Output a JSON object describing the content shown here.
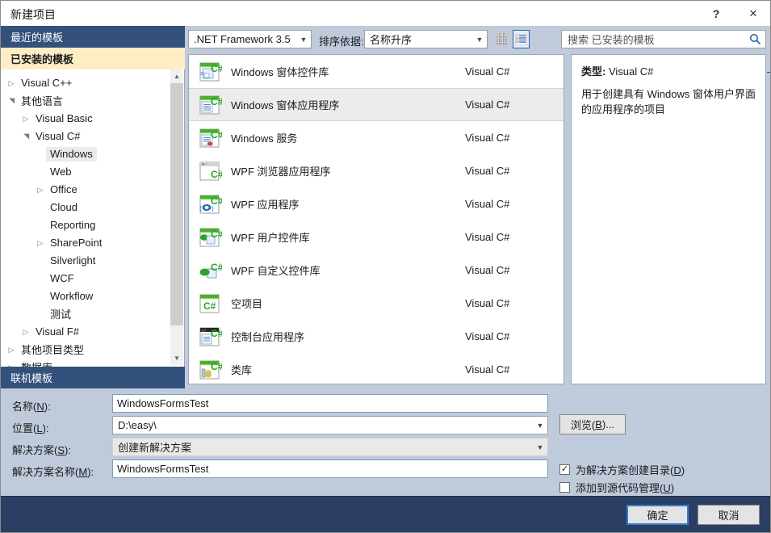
{
  "titlebar": {
    "title": "新建项目",
    "help_icon": "?",
    "close_icon": "×"
  },
  "sidebar": {
    "band_recent": "最近的模板",
    "band_installed": "已安装的模板",
    "band_online": "联机模板",
    "tree": [
      {
        "label": "Visual C++",
        "level": 0,
        "twisty": "collapsed",
        "selected": false
      },
      {
        "label": "其他语言",
        "level": 0,
        "twisty": "expanded",
        "selected": false
      },
      {
        "label": "Visual Basic",
        "level": 1,
        "twisty": "collapsed",
        "selected": false
      },
      {
        "label": "Visual C#",
        "level": 1,
        "twisty": "expanded",
        "selected": false
      },
      {
        "label": "Windows",
        "level": 2,
        "twisty": "none",
        "selected": true
      },
      {
        "label": "Web",
        "level": 2,
        "twisty": "none",
        "selected": false
      },
      {
        "label": "Office",
        "level": 2,
        "twisty": "collapsed",
        "selected": false
      },
      {
        "label": "Cloud",
        "level": 2,
        "twisty": "none",
        "selected": false
      },
      {
        "label": "Reporting",
        "level": 2,
        "twisty": "none",
        "selected": false
      },
      {
        "label": "SharePoint",
        "level": 2,
        "twisty": "collapsed",
        "selected": false
      },
      {
        "label": "Silverlight",
        "level": 2,
        "twisty": "none",
        "selected": false
      },
      {
        "label": "WCF",
        "level": 2,
        "twisty": "none",
        "selected": false
      },
      {
        "label": "Workflow",
        "level": 2,
        "twisty": "none",
        "selected": false
      },
      {
        "label": "测试",
        "level": 2,
        "twisty": "none",
        "selected": false
      },
      {
        "label": "Visual F#",
        "level": 1,
        "twisty": "collapsed",
        "selected": false
      },
      {
        "label": "其他项目类型",
        "level": 0,
        "twisty": "collapsed",
        "selected": false
      },
      {
        "label": "数据库",
        "level": 0,
        "twisty": "collapsed",
        "selected": false
      }
    ]
  },
  "toolbar": {
    "framework": ".NET Framework 3.5",
    "sort_label": "排序依据:",
    "sort_value": "名称升序",
    "view_medium_icon": "medium-icons-view-icon",
    "view_list_icon": "list-view-icon",
    "view_selected": "list"
  },
  "search": {
    "placeholder": "搜索 已安装的模板",
    "icon": "search-icon"
  },
  "templates": [
    {
      "name": "Windows 窗体控件库",
      "lang": "Visual C#",
      "icon": "winforms-control-library-icon",
      "selected": false
    },
    {
      "name": "Windows 窗体应用程序",
      "lang": "Visual C#",
      "icon": "winforms-app-icon",
      "selected": true
    },
    {
      "name": "Windows 服务",
      "lang": "Visual C#",
      "icon": "windows-service-icon",
      "selected": false
    },
    {
      "name": "WPF 浏览器应用程序",
      "lang": "Visual C#",
      "icon": "wpf-browser-app-icon",
      "selected": false
    },
    {
      "name": "WPF 应用程序",
      "lang": "Visual C#",
      "icon": "wpf-app-icon",
      "selected": false
    },
    {
      "name": "WPF 用户控件库",
      "lang": "Visual C#",
      "icon": "wpf-user-control-icon",
      "selected": false
    },
    {
      "name": "WPF 自定义控件库",
      "lang": "Visual C#",
      "icon": "wpf-custom-control-icon",
      "selected": false
    },
    {
      "name": "空项目",
      "lang": "Visual C#",
      "icon": "empty-project-icon",
      "selected": false
    },
    {
      "name": "控制台应用程序",
      "lang": "Visual C#",
      "icon": "console-app-icon",
      "selected": false
    },
    {
      "name": "类库",
      "lang": "Visual C#",
      "icon": "class-library-icon",
      "selected": false
    }
  ],
  "description": {
    "type_label": "类型:",
    "type_value": "Visual C#",
    "text": "用于创建具有 Windows 窗体用户界面的应用程序的项目",
    "edge_link": "（"
  },
  "form": {
    "name_label_pre": "名称(",
    "name_label_key": "N",
    "name_label_post": "):",
    "name_value": "WindowsFormsTest",
    "location_label_pre": "位置(",
    "location_label_key": "L",
    "location_label_post": "):",
    "location_value": "D:\\easy\\",
    "solution_label_pre": "解决方案(",
    "solution_label_key": "S",
    "solution_label_post": "):",
    "solution_value": "创建新解决方案",
    "solution_name_label_pre": "解决方案名称(",
    "solution_name_label_key": "M",
    "solution_name_label_post": "):",
    "solution_name_value": "WindowsFormsTest",
    "browse_pre": "浏览(",
    "browse_key": "B",
    "browse_post": ")...",
    "chk_dir_pre": "为解决方案创建目录(",
    "chk_dir_key": "D",
    "chk_dir_post": ")",
    "chk_dir_checked": true,
    "chk_scc_pre": "添加到源代码管理(",
    "chk_scc_key": "U",
    "chk_scc_post": ")",
    "chk_scc_checked": false,
    "check_glyph": "✓"
  },
  "footer": {
    "ok": "确定",
    "cancel": "取消"
  },
  "colors": {
    "band_navy": "#33517c",
    "band_cream": "#fdeec6",
    "dialog_bg": "#bfcadb",
    "footer_navy": "#2a3f63",
    "focus_blue": "#2f7fd0"
  }
}
